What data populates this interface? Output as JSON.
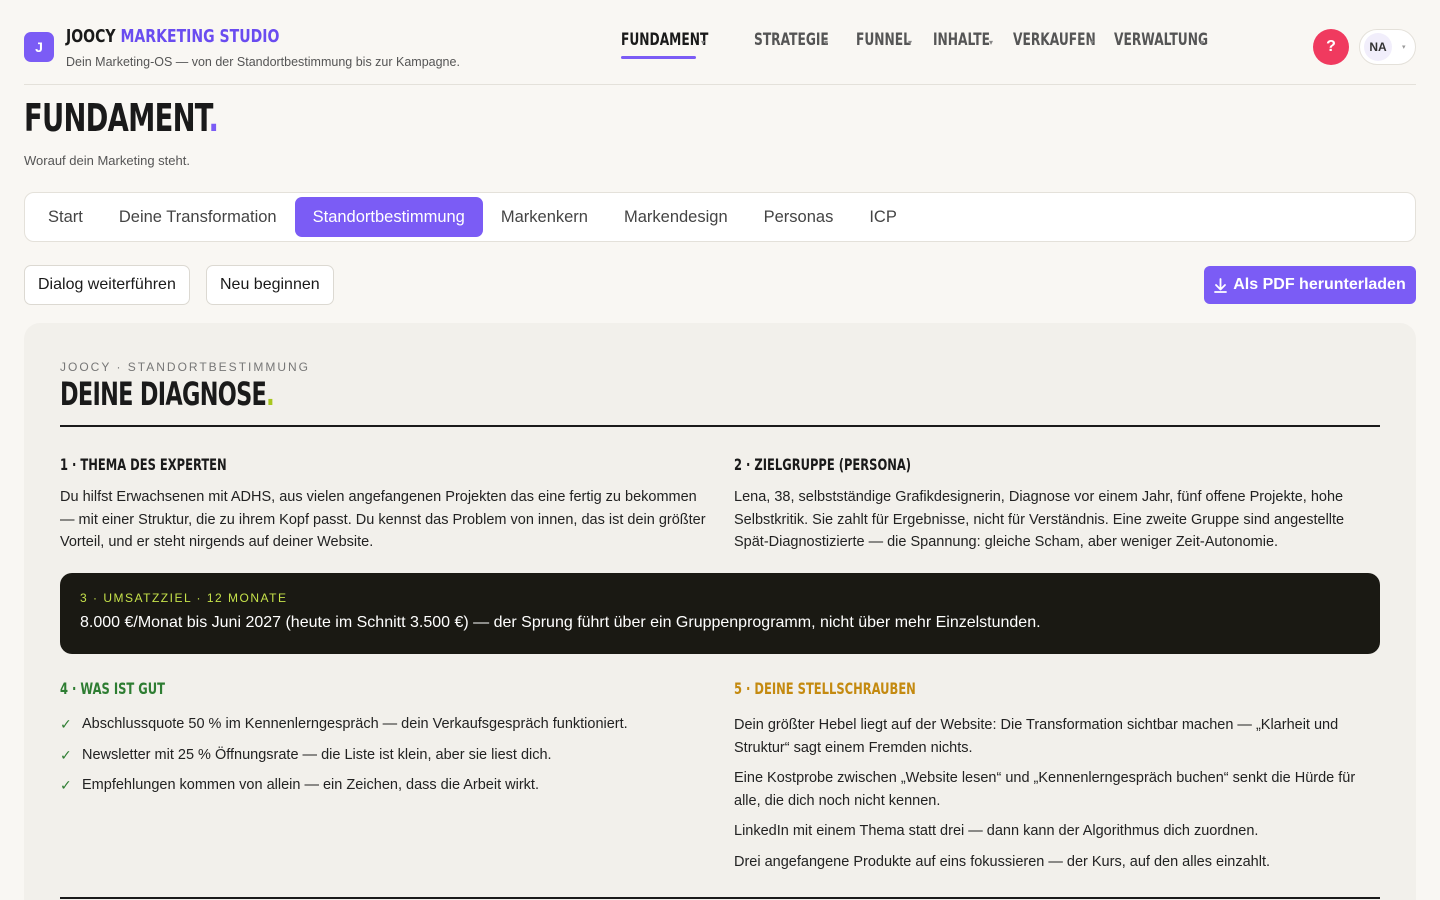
{
  "header": {
    "logo_letter": "J",
    "brand_part1": "JOOCY",
    "brand_part2": "MARKETING STUDIO",
    "tagline": "Dein Marketing-OS — von der Standortbestimmung bis zur Kampagne.",
    "nav": [
      {
        "label": "FUNDAMENT",
        "active": true
      },
      {
        "label": "STRATEGIE",
        "active": false
      },
      {
        "label": "FUNNEL",
        "active": false
      },
      {
        "label": "INHALTE",
        "active": false
      },
      {
        "label": "VERKAUFEN",
        "active": false
      },
      {
        "label": "VERWALTUNG",
        "active": false
      }
    ],
    "help_label": "?",
    "user_initials": "NA"
  },
  "page": {
    "title": "FUNDAMENT",
    "title_dot": ".",
    "subtitle": "Worauf dein Marketing steht."
  },
  "tabs": [
    {
      "label": "Start",
      "active": false
    },
    {
      "label": "Deine Transformation",
      "active": false
    },
    {
      "label": "Standortbestimmung",
      "active": true
    },
    {
      "label": "Markenkern",
      "active": false
    },
    {
      "label": "Markendesign",
      "active": false
    },
    {
      "label": "Personas",
      "active": false
    },
    {
      "label": "ICP",
      "active": false
    }
  ],
  "actions": {
    "continue_label": "Dialog weiterführen",
    "restart_label": "Neu beginnen",
    "pdf_label": "Als PDF herunterladen"
  },
  "diagnosis": {
    "eyebrow": "JOOCY · STANDORTBESTIMMUNG",
    "title": "DEINE DIAGNOSE",
    "title_dot": ".",
    "sec1": {
      "heading": "1 · THEMA DES EXPERTEN",
      "text": "Du hilfst Erwachsenen mit ADHS, aus vielen angefangenen Projekten das eine fertig zu bekommen — mit einer Struktur, die zu ihrem Kopf passt. Du kennst das Problem von innen, das ist dein größter Vorteil, und er steht nirgends auf deiner Website."
    },
    "sec2": {
      "heading": "2 · ZIELGRUPPE (PERSONA)",
      "text": "Lena, 38, selbstständige Grafikdesignerin, Diagnose vor einem Jahr, fünf offene Projekte, hohe Selbstkritik. Sie zahlt für Ergebnisse, nicht für Verständnis. Eine zweite Gruppe sind angestellte Spät-Diagnostizierte — die Spannung: gleiche Scham, aber weniger Zeit-Autonomie."
    },
    "sec3": {
      "label": "3 · UMSATZZIEL · 12 MONATE",
      "text": "8.000 €/Monat bis Juni 2027 (heute im Schnitt 3.500 €) — der Sprung führt über ein Gruppenprogramm, nicht über mehr Einzelstunden."
    },
    "sec4": {
      "heading": "4 · WAS IST GUT",
      "items": [
        "Abschlussquote 50 % im Kennenlerngespräch — dein Verkaufsgespräch funktioniert.",
        "Newsletter mit 25 % Öffnungsrate — die Liste ist klein, aber sie liest dich.",
        "Empfehlungen kommen von allein — ein Zeichen, dass die Arbeit wirkt."
      ]
    },
    "sec5": {
      "heading": "5 · DEINE STELLSCHRAUBEN",
      "items": [
        "Dein größter Hebel liegt auf der Website: Die Transformation sichtbar machen — „Klarheit und Struktur“ sagt einem Fremden nichts.",
        "Eine Kostprobe zwischen „Website lesen“ und „Kennenlerngespräch buchen“ senkt die Hürde für alle, die dich noch nicht kennen.",
        "LinkedIn mit einem Thema statt drei — dann kann der Algorithmus dich zuordnen.",
        "Drei angefangene Produkte auf eins fokussieren — der Kurs, auf den alles einzahlt."
      ]
    }
  },
  "colors": {
    "accent": "#7b5cf5",
    "help": "#f03a5f",
    "good": "#2e7d32",
    "screws": "#c48a10",
    "goal_label": "#c5e14a"
  }
}
